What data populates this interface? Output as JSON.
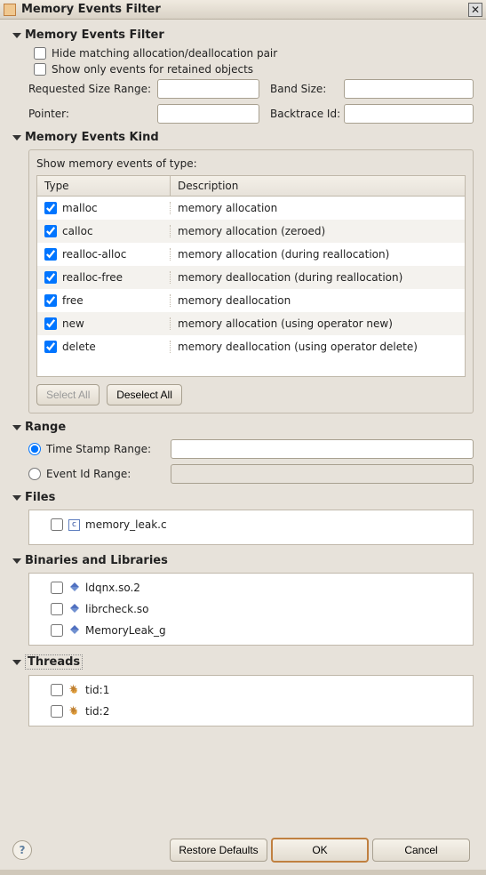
{
  "window": {
    "title": "Memory Events Filter"
  },
  "filter": {
    "title": "Memory Events Filter",
    "hide_pair": "Hide matching allocation/deallocation pair",
    "retained": "Show only events for retained objects",
    "req_size": "Requested Size Range:",
    "band_size": "Band Size:",
    "pointer": "Pointer:",
    "backtrace": "Backtrace Id:"
  },
  "kind": {
    "title": "Memory Events Kind",
    "show_label": "Show memory events of type:",
    "col_type": "Type",
    "col_desc": "Description",
    "rows": [
      {
        "t": "malloc",
        "d": "memory allocation"
      },
      {
        "t": "calloc",
        "d": "memory allocation (zeroed)"
      },
      {
        "t": "realloc-alloc",
        "d": "memory allocation (during reallocation)"
      },
      {
        "t": "realloc-free",
        "d": "memory deallocation (during reallocation)"
      },
      {
        "t": "free",
        "d": "memory deallocation"
      },
      {
        "t": "new",
        "d": "memory allocation (using operator new)"
      },
      {
        "t": "delete",
        "d": "memory deallocation (using operator delete)"
      }
    ],
    "select_all": "Select All",
    "deselect_all": "Deselect All"
  },
  "range": {
    "title": "Range",
    "ts": "Time Stamp Range:",
    "eid": "Event Id Range:"
  },
  "files": {
    "title": "Files",
    "items": [
      "memory_leak.c"
    ]
  },
  "binaries": {
    "title": "Binaries and Libraries",
    "items": [
      "ldqnx.so.2",
      "librcheck.so",
      "MemoryLeak_g"
    ]
  },
  "threads": {
    "title": "Threads",
    "items": [
      "tid:1",
      "tid:2"
    ]
  },
  "buttons": {
    "restore": "Restore Defaults",
    "ok": "OK",
    "cancel": "Cancel"
  }
}
